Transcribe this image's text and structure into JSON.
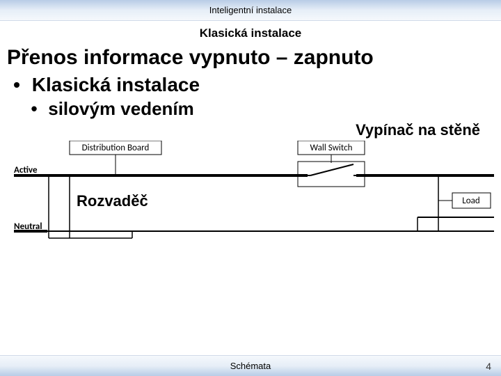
{
  "header": {
    "course": "Inteligentní instalace",
    "section": "Klasická instalace"
  },
  "main": {
    "title": "Přenos informace vypnuto – zapnuto",
    "bullets": [
      {
        "text": "Klasická instalace",
        "children": [
          {
            "text": "silovým vedením"
          }
        ]
      }
    ],
    "callout_right": "Vypínač na stěně",
    "rozvadec_label": "Rozvaděč"
  },
  "diagram": {
    "distribution_board": "Distribution Board",
    "wall_switch": "Wall Switch",
    "active": "Active",
    "neutral": "Neutral",
    "load": "Load"
  },
  "footer": {
    "label": "Schémata",
    "page": "4"
  }
}
